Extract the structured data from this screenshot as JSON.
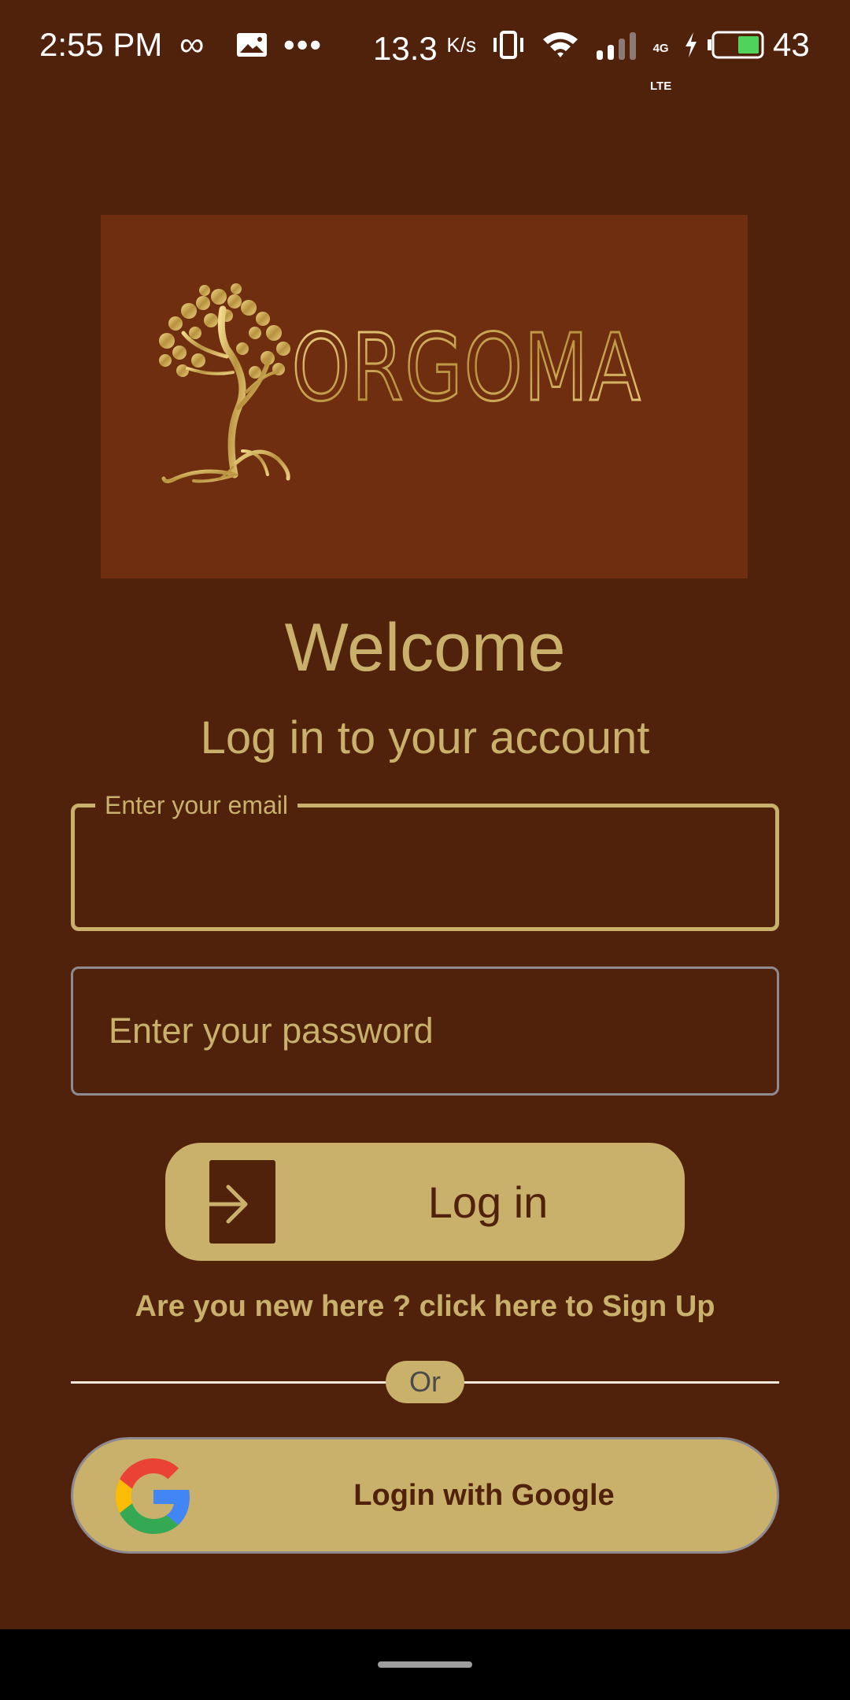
{
  "status_bar": {
    "time": "2:55 PM",
    "infinity_glyph": "∞",
    "dots": "•••",
    "net_speed": "13.3",
    "net_unit": "K/s",
    "network_type_top": "4G",
    "network_type_bottom": "LTE",
    "battery_level": "43",
    "icons": [
      "infinity-icon",
      "image-icon",
      "more-dots-icon",
      "vibrate-icon",
      "wifi-icon",
      "signal-icon",
      "charging-icon",
      "battery-icon"
    ]
  },
  "logo": {
    "brand_name": "ORGOMA",
    "icon": "tree-icon"
  },
  "welcome": {
    "title": "Welcome",
    "subtitle": "Log in to your account"
  },
  "form": {
    "email_label": "Enter your email",
    "email_value": "",
    "password_placeholder": "Enter your password",
    "password_value": ""
  },
  "login_button": {
    "label": "Log in",
    "icon": "login-arrow-icon"
  },
  "signup_link": "Are you new here ? click here to Sign Up",
  "divider": {
    "label": "Or"
  },
  "google_button": {
    "label": "Login with Google",
    "icon": "google-icon"
  },
  "colors": {
    "background": "#50220c",
    "banner": "#702e10",
    "gold": "#c9b06b",
    "outline_gray": "#8f8a90",
    "nav_bar": "#000000"
  }
}
